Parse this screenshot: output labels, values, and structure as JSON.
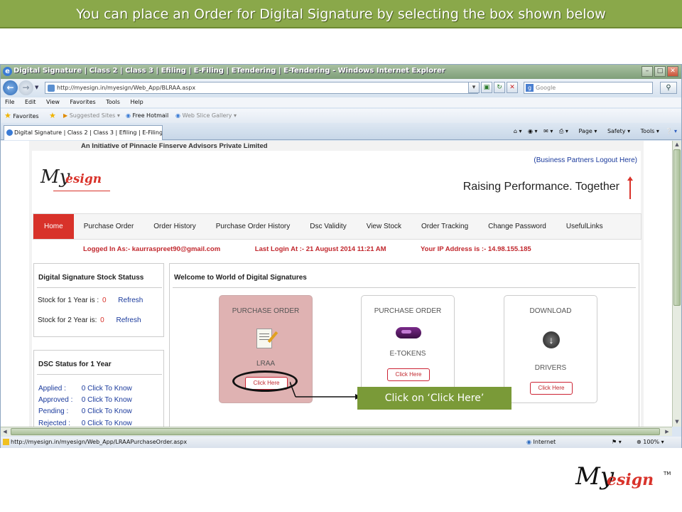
{
  "slide": {
    "banner_text": "You can place an Order for Digital Signature by selecting the box shown below",
    "callout_text": "Click on ‘Click Here’",
    "corner_logo": {
      "my": "My",
      "esign": "esign",
      "tm": "TM"
    }
  },
  "browser": {
    "title": "Digital Signature | Class 2 | Class 3 | Efiling | E-Filing | ETendering | E-Tendering - Windows Internet Explorer",
    "address": "http://myesign.in/myesign/Web_App/BLRAA.aspx",
    "search_placeholder": "Google",
    "menu": [
      "File",
      "Edit",
      "View",
      "Favorites",
      "Tools",
      "Help"
    ],
    "favorites_label": "Favorites",
    "fav_links": [
      "Suggested Sites",
      "Free Hotmail",
      "Web Slice Gallery"
    ],
    "tab_title": "Digital Signature | Class 2 | Class 3 | Efiling | E-Filing | ...",
    "commands": [
      "Page",
      "Safety",
      "Tools"
    ],
    "status_url": "http://myesign.in/myesign/Web_App/LRAAPurchaseOrder.aspx",
    "status_zone": "Internet",
    "status_zoom": "100%"
  },
  "site": {
    "initiative": "An Initiative of Pinnacle Finserve Advisors Private Limited",
    "partner_logout": "(Business Partners Logout Here)",
    "logo_my": "My",
    "logo_esign": "esign",
    "tagline": "Raising Performance. Together",
    "nav": [
      "Home",
      "Purchase Order",
      "Order History",
      "Purchase Order History",
      "Dsc Validity",
      "View Stock",
      "Order Tracking",
      "Change Password",
      "UsefulLinks"
    ],
    "logged_in": "Logged  In As:-  kaurraspreet90@gmail.com",
    "last_login": "Last Login At :- 21 August 2014 11:21 AM",
    "ip": "Your IP Address is :- 14.98.155.185",
    "stock": {
      "title": "Digital Signature Stock Statuss",
      "rows": [
        {
          "label": "Stock for 1 Year is :",
          "value": "0",
          "action": "Refresh"
        },
        {
          "label": "Stock for 2 Year is:",
          "value": "0",
          "action": "Refresh"
        }
      ]
    },
    "dsc": {
      "title": "DSC Status for 1 Year",
      "rows": [
        {
          "label": "Applied :",
          "value": "0",
          "action": "Click To Know"
        },
        {
          "label": "Approved :",
          "value": "0",
          "action": "Click To Know"
        },
        {
          "label": "Pending :",
          "value": "0",
          "action": "Click To Know"
        },
        {
          "label": "Rejected :",
          "value": "0",
          "action": "Click To Know"
        }
      ]
    },
    "welcome_title": "Welcome to World of Digital Signatures",
    "cards": [
      {
        "head": "PURCHASE ORDER",
        "sub": "LRAA",
        "button": "Click Here"
      },
      {
        "head": "PURCHASE ORDER",
        "sub": "E-TOKENS",
        "button": "Click Here"
      },
      {
        "head": "DOWNLOAD",
        "sub": "DRIVERS",
        "button": "Click Here"
      }
    ]
  }
}
